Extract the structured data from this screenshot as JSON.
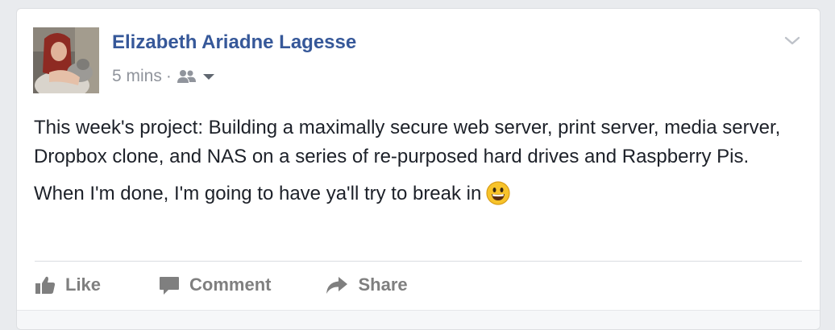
{
  "post": {
    "author": "Elizabeth Ariadne Lagesse",
    "timestamp": "5 mins",
    "separator": "·",
    "audience_icon": "friends-icon",
    "paragraphs": [
      "This week's project: Building a maximally secure web server, print server, media server, Dropbox clone, and NAS on a series of re-purposed hard drives and Raspberry Pis.",
      "When I'm done, I'm going to have ya'll try to break in"
    ],
    "emoji": "grinning-face-emoji"
  },
  "actions": {
    "like": "Like",
    "comment": "Comment",
    "share": "Share"
  },
  "colors": {
    "author_link": "#365899",
    "meta_text": "#90949c",
    "body_text": "#1d2129",
    "action_text": "#7f7f7f",
    "page_background": "#e9ebee"
  }
}
